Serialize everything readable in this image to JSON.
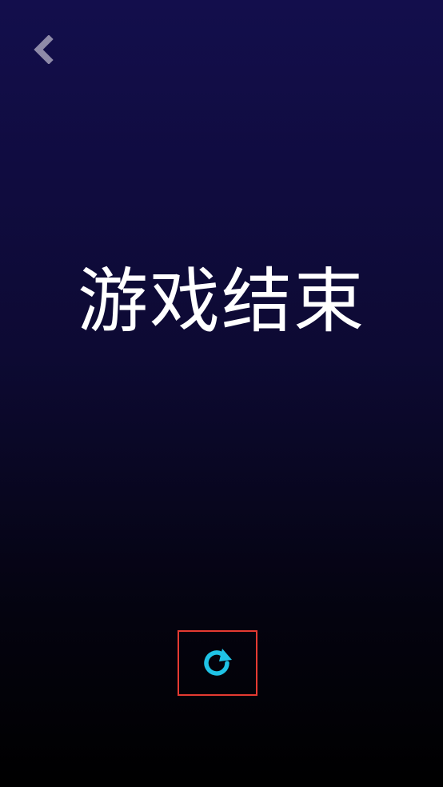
{
  "screen": {
    "title": "游戏结束"
  },
  "icons": {
    "back": "chevron-left-icon",
    "restart": "refresh-icon"
  },
  "colors": {
    "accent": "#1fc3e6",
    "highlight_border": "#e53a32",
    "back_icon": "#8e8aa8",
    "text": "#ffffff"
  }
}
